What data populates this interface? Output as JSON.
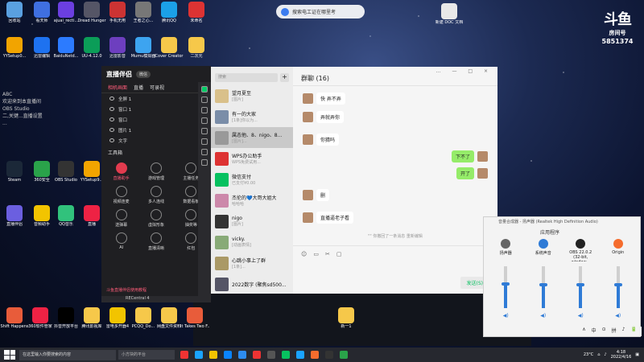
{
  "wallpaper": {
    "accent": "#1c2a52"
  },
  "desktop_icons": [
    {
      "label": "回收站",
      "color": "#5aa0e0"
    },
    {
      "label": "看天师",
      "color": "#3f6fe0"
    },
    {
      "label": "ajuai_recti...",
      "color": "#6b3fe0"
    },
    {
      "label": "Dread Hunger",
      "color": "#556"
    },
    {
      "label": "手机无用",
      "color": "#c33"
    },
    {
      "label": "王者之心...",
      "color": "#777"
    },
    {
      "label": "腾讯QQ",
      "color": "#1ba0e8"
    },
    {
      "label": "未命名",
      "color": "#d33"
    },
    {
      "label": "YYSetup0...",
      "color": "#f2a400"
    },
    {
      "label": "迅雷编辑",
      "color": "#1e72f0"
    },
    {
      "label": "BaiduNetd...",
      "color": "#2c7bff"
    },
    {
      "label": "UU-4.12.0",
      "color": "#0b9d58"
    },
    {
      "label": "迅雷影音",
      "color": "#6d3fbf"
    },
    {
      "label": "Mumu模拟器",
      "color": "#3da4f0"
    },
    {
      "label": "Cover Creator",
      "color": "#f6c84a"
    },
    {
      "label": "二次元",
      "color": "#f6c84a"
    },
    {
      "label": "Steam",
      "color": "#1b2838"
    },
    {
      "label": "360安全",
      "color": "#2aa34a"
    },
    {
      "label": "OBS Studio",
      "color": "#333"
    },
    {
      "label": "YYSetup9...",
      "color": "#f2a400"
    },
    {
      "label": "直播伴侣",
      "color": "#6b5fe0"
    },
    {
      "label": "音频助手",
      "color": "#f2c400"
    },
    {
      "label": "QQ音乐",
      "color": "#31c27c"
    },
    {
      "label": "直播",
      "color": "#e24"
    }
  ],
  "taskbar_apps": [
    {
      "label": "Shift Happens",
      "color": "#e85c3a"
    },
    {
      "label": "360软件管家",
      "color": "#e24"
    },
    {
      "label": "抖音开放平台",
      "color": "#000"
    },
    {
      "label": "腾讯影视库",
      "color": "#f6c84a"
    },
    {
      "label": "雷电多开器4",
      "color": "#f2c400"
    },
    {
      "label": "PCQQ_Do...",
      "color": "#f6c84a"
    },
    {
      "label": "网盘文件资料",
      "color": "#f6c84a"
    },
    {
      "label": "It Takes Two F...",
      "color": "#e85c3a"
    },
    {
      "label": "新一1",
      "color": "#f6c84a"
    }
  ],
  "search_pill": "搜索电工证在哪里考",
  "new_doc": "新建 DOC 文档",
  "douyu": {
    "logo": "斗鱼",
    "sub": "房间号",
    "room": "5851374"
  },
  "left_panel": [
    "ABC",
    "欢迎来到本直播间",
    "OBS Studio",
    "二,关键...直播设置",
    "..."
  ],
  "live": {
    "logo": "直播伴侣",
    "badge": "微信",
    "tabs": [
      "相机画面",
      "直播",
      "可录视"
    ],
    "layers": [
      "全屏 1",
      "窗口 1",
      "窗口",
      "图片 1",
      "文字"
    ],
    "tools_title": "工具箱",
    "tools": [
      "直播助手",
      "游戏管理",
      "主播任务",
      "视频连麦",
      "多人连线",
      "数据看板",
      "送弹幕",
      "虚拟形象",
      "抽奖等",
      "AI",
      "直播清晰",
      "红包"
    ],
    "footer": "斗鱼直播伴侣使用教程",
    "recentral": "RECentral 4"
  },
  "wechat": {
    "search_placeholder": "搜索",
    "chats": [
      {
        "name": "望月夏至",
        "preview": "[图片]",
        "color": "#d9c08a",
        "selected": false
      },
      {
        "name": "有一的大家",
        "preview": "[1条]你以为...",
        "color": "#7a8da8",
        "selected": false
      },
      {
        "name": "属态他、8、nigo、8...",
        "preview": "[图片]...",
        "color": "#999",
        "selected": true
      },
      {
        "name": "WPS办公助手",
        "preview": "WPS免费试用...",
        "color": "#d33",
        "selected": false
      },
      {
        "name": "微信支付",
        "preview": "已支付¥0.00",
        "color": "#07c160",
        "selected": false
      },
      {
        "name": "杰伦的💙大哥大姐大",
        "preview": "哈哈哈",
        "color": "#c8a",
        "selected": false
      },
      {
        "name": "nigo",
        "preview": "[图片]",
        "color": "#333",
        "selected": false
      },
      {
        "name": "vicky.",
        "preview": "[动画表情]",
        "color": "#8a7",
        "selected": false
      },
      {
        "name": "心跳小事上了群",
        "preview": "[1条]...",
        "color": "#a96",
        "selected": false
      },
      {
        "name": "2022数字 (聚焦sd500...",
        "preview": "",
        "color": "#556",
        "selected": false
      }
    ],
    "title": "群聊 (16)",
    "window_controls": "… — □ ×",
    "messages": [
      {
        "text": "快 弄不弄",
        "me": false
      },
      {
        "text": "弄就弄你",
        "me": false
      },
      {
        "text": "你猜吗",
        "me": false
      },
      {
        "text": "下不了",
        "me": true
      },
      {
        "text": "开了",
        "me": true
      },
      {
        "text": "删",
        "me": false
      },
      {
        "text": "直播逼老子看",
        "me": false
      }
    ],
    "system_msg": "\"\" 你撤回了一条消息 重新编辑",
    "send": "发送(S)",
    "input_icons": [
      "☺",
      "▭",
      "✂",
      "▢"
    ]
  },
  "mixer": {
    "title": "音量合成器 - 扬声器 (Realtek High Definition Audio)",
    "section": "应用程序",
    "apps": [
      {
        "label": "扬声器",
        "level": 0.58,
        "color": "#666"
      },
      {
        "label": "系统声音",
        "level": 0.55,
        "color": "#2f7bd6"
      },
      {
        "label": "OBS 22.0.2 (32-bit, window...",
        "level": 0.55,
        "color": "#222"
      },
      {
        "label": "Origin",
        "level": 0.55,
        "color": "#f56c2d"
      }
    ],
    "tray": [
      "∧",
      "中",
      "⊙",
      "拼",
      "♪",
      "🔋"
    ]
  },
  "taskbar": {
    "search_placeholder": "在这里输入你要搜索的内容",
    "task_hint": "小方块的平台",
    "weather": "23°C",
    "time": "4:18",
    "date": "2022/4/16",
    "icon_colors": [
      "#e33",
      "#1aa3ff",
      "#f2c400",
      "#0a84ff",
      "#2d8cf0",
      "#e33",
      "#555",
      "#07c160",
      "#1aa3ff",
      "#f56c2d",
      "#333",
      "#2aa34a"
    ]
  }
}
